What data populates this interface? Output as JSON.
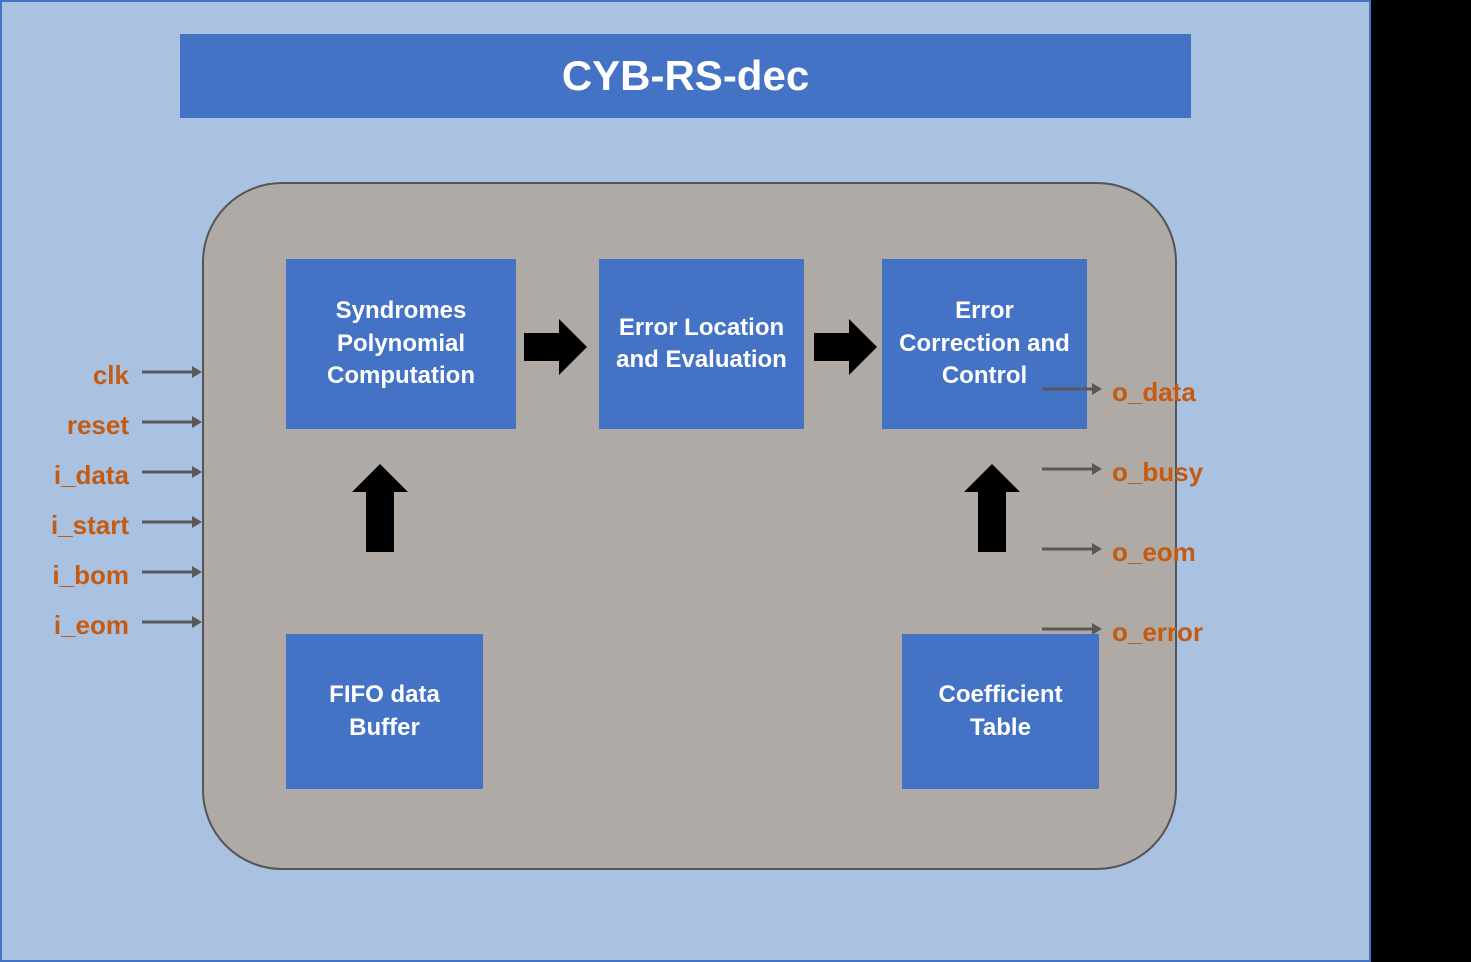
{
  "title": "CYB-RS-dec",
  "blocks": {
    "syndromes": "Syndromes Polynomial Computation",
    "error_location": "Error Location and Evaluation",
    "error_correction": "Error Correction and Control",
    "fifo": "FIFO data Buffer",
    "coefficient": "Coefficient Table"
  },
  "inputs": {
    "clk": "clk",
    "reset": "reset",
    "i_data": "i_data",
    "i_start": "i_start",
    "i_bom": "i_bom",
    "i_eom": "i_eom"
  },
  "outputs": {
    "o_data": "o_data",
    "o_busy": "o_busy",
    "o_eom": "o_eom",
    "o_error": "o_error"
  }
}
